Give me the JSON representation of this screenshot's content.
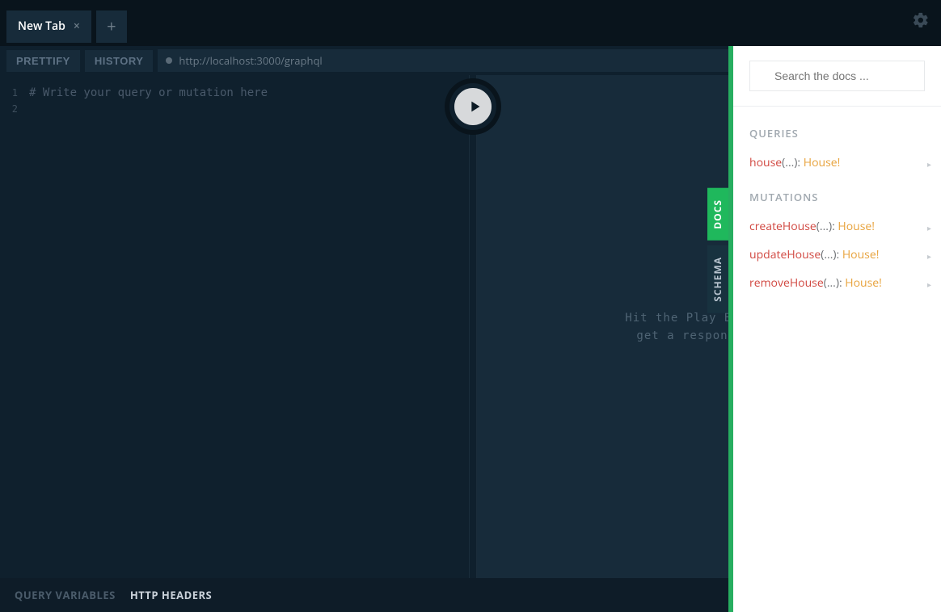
{
  "tabbar": {
    "tab_label": "New Tab",
    "close_glyph": "×",
    "add_glyph": "+"
  },
  "toolbar": {
    "prettify_label": "PRETTIFY",
    "history_label": "HISTORY",
    "endpoint_url": "http://localhost:3000/graphql"
  },
  "editor": {
    "line1": "1",
    "line2": "2",
    "placeholder_comment": "# Write your query or mutation here"
  },
  "response": {
    "hint_text": "Hit the Play Button to\nget a response here"
  },
  "side_tabs": {
    "docs": "DOCS",
    "schema": "SCHEMA"
  },
  "bottombar": {
    "query_variables": "QUERY VARIABLES",
    "http_headers": "HTTP HEADERS"
  },
  "docs": {
    "search_placeholder": "Search the docs ...",
    "sections": {
      "queries_title": "QUERIES",
      "mutations_title": "MUTATIONS"
    },
    "queries": [
      {
        "name": "house",
        "args": "(...): ",
        "type": "House!"
      }
    ],
    "mutations": [
      {
        "name": "createHouse",
        "args": "(...): ",
        "type": "House!"
      },
      {
        "name": "updateHouse",
        "args": "(...): ",
        "type": "House!"
      },
      {
        "name": "removeHouse",
        "args": "(...): ",
        "type": "House!"
      }
    ]
  }
}
